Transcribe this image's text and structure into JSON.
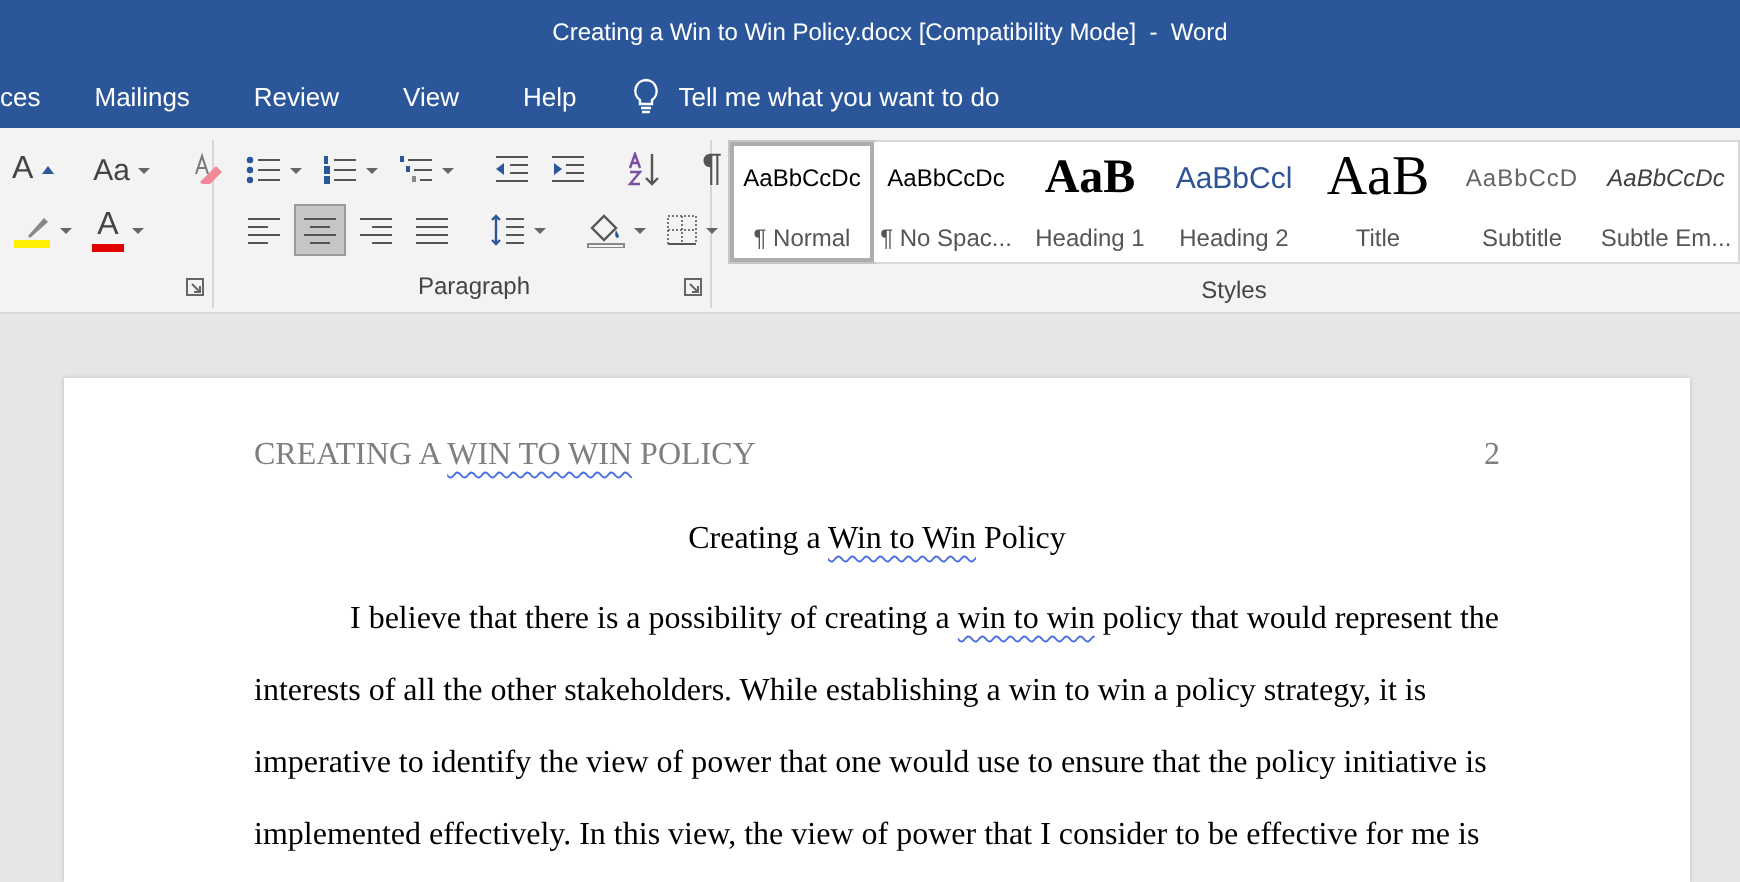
{
  "window": {
    "title": "Creating a Win to Win Policy.docx [Compatibility Mode]  -  Word"
  },
  "tabs": [
    {
      "label": "ces",
      "selected": false
    },
    {
      "label": "Mailings",
      "selected": false
    },
    {
      "label": "Review",
      "selected": false
    },
    {
      "label": "View",
      "selected": false
    },
    {
      "label": "Help",
      "selected": false
    }
  ],
  "tell_me": {
    "placeholder": "Tell me what you want to do"
  },
  "font_group": {
    "row1": [
      {
        "kind": "grow",
        "glyph": "A"
      },
      {
        "kind": "sep"
      },
      {
        "kind": "case",
        "glyph": "Aa",
        "dropdown": true
      },
      {
        "kind": "sep"
      },
      {
        "kind": "clear"
      }
    ],
    "row2": [
      {
        "kind": "highlight",
        "dropdown": true
      },
      {
        "kind": "color",
        "glyph": "A",
        "dropdown": true
      }
    ]
  },
  "paragraph_group": {
    "label": "Paragraph",
    "row1": [
      {
        "kind": "bullets",
        "dropdown": true
      },
      {
        "kind": "numbering",
        "dropdown": true
      },
      {
        "kind": "multilevel",
        "dropdown": true
      },
      {
        "kind": "sep"
      },
      {
        "kind": "outdent"
      },
      {
        "kind": "indent"
      },
      {
        "kind": "sep"
      },
      {
        "kind": "sort"
      },
      {
        "kind": "sep"
      },
      {
        "kind": "marks",
        "glyph": "¶"
      }
    ],
    "row2": [
      {
        "kind": "align-left",
        "selected": false
      },
      {
        "kind": "align-center",
        "selected": true
      },
      {
        "kind": "align-right",
        "selected": false
      },
      {
        "kind": "justify",
        "selected": false
      },
      {
        "kind": "sep"
      },
      {
        "kind": "spacing",
        "dropdown": true
      },
      {
        "kind": "sep"
      },
      {
        "kind": "shading",
        "dropdown": true
      },
      {
        "kind": "borders",
        "dropdown": true
      }
    ]
  },
  "styles_group": {
    "label": "Styles",
    "items": [
      {
        "kind": "normal",
        "preview": "AaBbCcDc",
        "name": "¶ Normal",
        "selected": true
      },
      {
        "kind": "nospacing",
        "preview": "AaBbCcDc",
        "name": "¶ No Spac...",
        "selected": false
      },
      {
        "kind": "heading1",
        "preview": "AaB",
        "name": "Heading 1",
        "selected": false
      },
      {
        "kind": "heading2",
        "preview": "AaBbCcl",
        "name": "Heading 2",
        "selected": false
      },
      {
        "kind": "title",
        "preview": "AaB",
        "name": "Title",
        "selected": false
      },
      {
        "kind": "subtitle",
        "preview": "AaBbCcD",
        "name": "Subtitle",
        "selected": false
      },
      {
        "kind": "emphasis",
        "preview": "AaBbCcDc",
        "name": "Subtle Em...",
        "selected": false
      }
    ]
  },
  "document": {
    "header": [
      {
        "text": "CREATING A ",
        "flagged": false
      },
      {
        "text": "WIN TO WIN",
        "flagged": true
      },
      {
        "text": " POLICY",
        "flagged": false
      }
    ],
    "page_number": "2",
    "title": [
      {
        "text": "Creating a ",
        "flagged": false
      },
      {
        "text": "Win to Win",
        "flagged": true
      },
      {
        "text": " Policy",
        "flagged": false
      }
    ],
    "paragraph": [
      {
        "text": "I believe that there is a possibility of creating a ",
        "flagged": false
      },
      {
        "text": "win to win",
        "flagged": true
      },
      {
        "text": " policy that would represent the interests of all the other stakeholders. While establishing a win to win a policy strategy, it is imperative to identify the view of power that one would use to ensure that the policy initiative is implemented effectively. In this view, the view of power that I consider to be effective for me is",
        "flagged": false
      }
    ]
  }
}
